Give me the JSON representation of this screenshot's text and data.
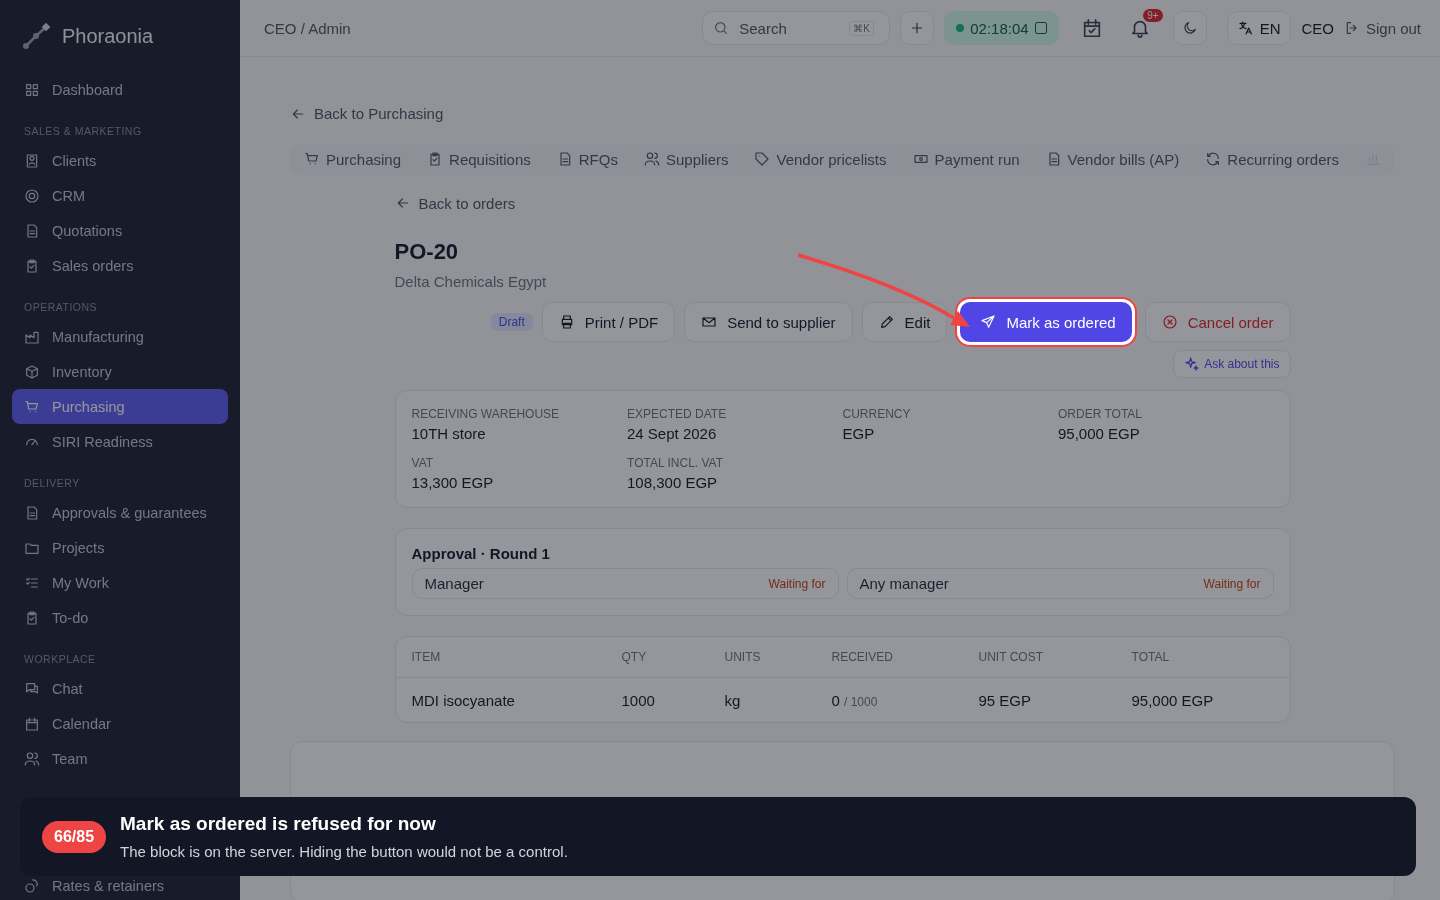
{
  "app": {
    "name": "Phoraonia"
  },
  "sidebar": {
    "sections": [
      {
        "items": [
          {
            "label": "Dashboard",
            "selected": false
          }
        ]
      },
      {
        "heading": "SALES & MARKETING",
        "items": [
          {
            "label": "Clients",
            "selected": false
          },
          {
            "label": "CRM",
            "selected": false
          },
          {
            "label": "Quotations",
            "selected": false
          },
          {
            "label": "Sales orders",
            "selected": false
          }
        ]
      },
      {
        "heading": "OPERATIONS",
        "items": [
          {
            "label": "Manufacturing",
            "selected": false
          },
          {
            "label": "Inventory",
            "selected": false
          },
          {
            "label": "Purchasing",
            "selected": true
          },
          {
            "label": "SIRI Readiness",
            "selected": false
          }
        ]
      },
      {
        "heading": "DELIVERY",
        "items": [
          {
            "label": "Approvals & guarantees",
            "selected": false
          },
          {
            "label": "Projects",
            "selected": false
          },
          {
            "label": "My Work",
            "selected": false
          },
          {
            "label": "To-do",
            "selected": false
          }
        ]
      },
      {
        "heading": "WORKPLACE",
        "items": [
          {
            "label": "Chat",
            "selected": false
          },
          {
            "label": "Calendar",
            "selected": false
          },
          {
            "label": "Team",
            "selected": false
          },
          {
            "label": "Rates & retainers",
            "selected": false
          }
        ]
      }
    ]
  },
  "topbar": {
    "breadcrumb": "CEO / Admin",
    "search": {
      "placeholder": "Search",
      "shortcut": "⌘K"
    },
    "timer": "02:18:04",
    "notifications": "9+",
    "language": "EN",
    "user": "CEO",
    "sign_out": "Sign out"
  },
  "back_link": "Back to Purchasing",
  "tabs": [
    "Purchasing",
    "Requisitions",
    "RFQs",
    "Suppliers",
    "Vendor pricelists",
    "Payment run",
    "Vendor bills (AP)",
    "Recurring orders"
  ],
  "order": {
    "back_link": "Back to orders",
    "number": "PO-20",
    "supplier": "Delta Chemicals Egypt",
    "status": "Draft",
    "actions": [
      {
        "label": "Print / PDF",
        "kind": "print"
      },
      {
        "label": "Send to supplier",
        "kind": "mail"
      },
      {
        "label": "Edit",
        "kind": "edit"
      },
      {
        "label": "Mark as ordered",
        "kind": "primary"
      },
      {
        "label": "Cancel order",
        "kind": "danger"
      }
    ],
    "ask": "Ask about this",
    "fields": [
      {
        "label": "RECEIVING WAREHOUSE",
        "value": "10TH store"
      },
      {
        "label": "EXPECTED DATE",
        "value": "24 Sept 2026"
      },
      {
        "label": "CURRENCY",
        "value": "EGP"
      },
      {
        "label": "ORDER TOTAL",
        "value": "95,000 EGP"
      },
      {
        "label": "VAT",
        "value": "13,300 EGP"
      },
      {
        "label": "TOTAL INCL. VAT",
        "value": "108,300 EGP"
      }
    ],
    "approval": {
      "title": "Approval · Round 1",
      "approvers": [
        {
          "name": "Manager",
          "status": "Waiting for"
        },
        {
          "name": "Any manager",
          "status": "Waiting for"
        }
      ]
    },
    "table": {
      "columns": [
        "ITEM",
        "QTY",
        "UNITS",
        "RECEIVED",
        "UNIT COST",
        "TOTAL"
      ],
      "rows": [
        {
          "item": "MDI isocyanate",
          "qty": "1000",
          "units": "kg",
          "received": "0",
          "received_of": "/ 1000",
          "unit_cost": "95 EGP",
          "total": "95,000 EGP"
        }
      ]
    }
  },
  "toast": {
    "badge": "66/85",
    "title": "Mark as ordered is refused for now",
    "message": "The block is on the server. Hiding the button would not be a control."
  }
}
